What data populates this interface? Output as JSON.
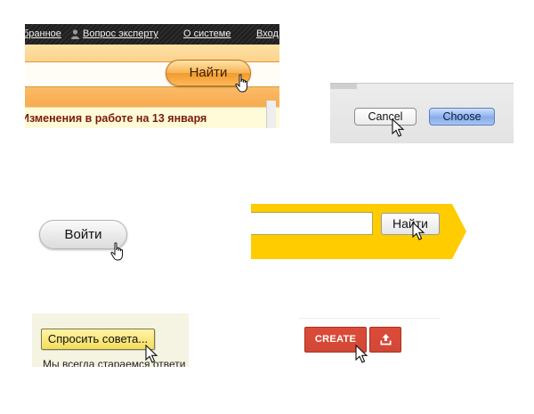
{
  "panel_search_orange": {
    "nav": {
      "favorites_fragment": "бранное",
      "expert_question": "Вопрос эксперту",
      "about": "О системе",
      "login_fragment": "Вход"
    },
    "search_button": "Найти",
    "news_text": "Изменения в работе на 13 января"
  },
  "panel_mac_dialog": {
    "cancel_label": "Cancel",
    "choose_label": "Choose"
  },
  "panel_login_pill": {
    "login_label": "Войти"
  },
  "panel_search_yellow": {
    "search_button": "Найти"
  },
  "panel_ask": {
    "ask_button": "Спросить совета...",
    "caption": "Мы всегда стараемся ответи"
  },
  "panel_create": {
    "create_label": "CREATE"
  },
  "icons": {
    "person": "person-icon",
    "hand_cursor": "hand-cursor-icon",
    "arrow_cursor": "arrow-cursor-icon",
    "upload": "upload-icon"
  },
  "colors": {
    "orange_accent": "#f9b35b",
    "yellow_band": "#ffcc00",
    "google_red": "#d14836",
    "mac_blue": "#8fb2ee"
  }
}
